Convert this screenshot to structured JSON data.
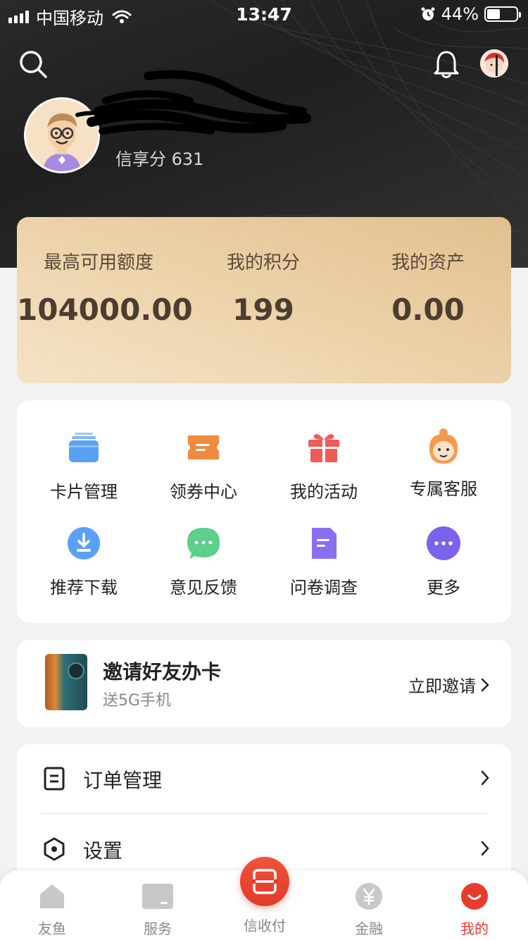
{
  "status_bar": {
    "carrier": "中国移动",
    "time": "13:47",
    "battery_percent": "44%",
    "battery_level": 0.44
  },
  "profile": {
    "score_label": "信享分 631"
  },
  "account": {
    "stats": [
      {
        "label": "最高可用额度",
        "value": "104000.00"
      },
      {
        "label": "我的积分",
        "value": "199"
      },
      {
        "label": "我的资产",
        "value": "0.00"
      }
    ]
  },
  "services": {
    "items": [
      {
        "label": "卡片管理",
        "icon": "card-stack-icon",
        "color": "#5aa0f5"
      },
      {
        "label": "领券中心",
        "icon": "coupon-icon",
        "color": "#f08a3c"
      },
      {
        "label": "我的活动",
        "icon": "gift-icon",
        "color": "#ef5a5a"
      },
      {
        "label": "专属客服",
        "icon": "customer-service-icon",
        "color": "#f49a4a"
      },
      {
        "label": "推荐下载",
        "icon": "download-icon",
        "color": "#5aa0f5"
      },
      {
        "label": "意见反馈",
        "icon": "chat-bubble-icon",
        "color": "#5ccf8a"
      },
      {
        "label": "问卷调查",
        "icon": "document-icon",
        "color": "#8a6ef0"
      },
      {
        "label": "更多",
        "icon": "more-dots-icon",
        "color": "#7a62ec"
      }
    ]
  },
  "invite": {
    "title": "邀请好友办卡",
    "subtitle": "送5G手机",
    "action": "立即邀请"
  },
  "menu": {
    "items": [
      {
        "label": "订单管理",
        "icon": "order-list-icon"
      },
      {
        "label": "设置",
        "icon": "settings-hex-icon"
      }
    ]
  },
  "tabbar": {
    "tabs": [
      {
        "label": "友鱼",
        "icon": "home-icon"
      },
      {
        "label": "服务",
        "icon": "service-card-icon"
      },
      {
        "label": "信收付",
        "icon": "scan-icon"
      },
      {
        "label": "金融",
        "icon": "yuan-icon"
      },
      {
        "label": "我的",
        "icon": "profile-icon"
      }
    ],
    "active": "我的",
    "accent": "#e83a2d"
  }
}
